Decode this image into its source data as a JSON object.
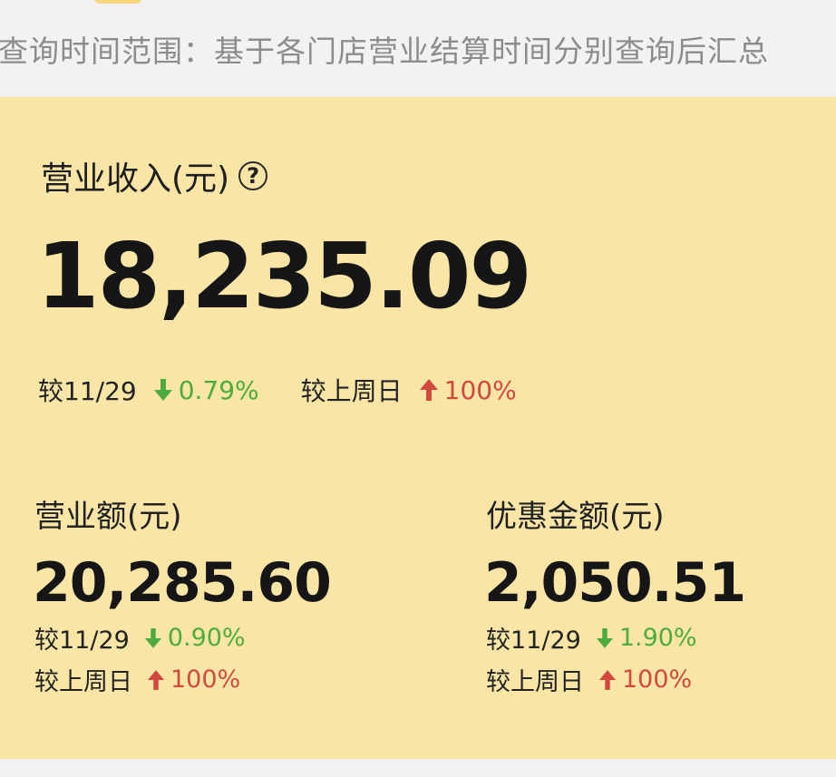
{
  "header": {
    "query_range": "查询时间范围：基于各门店营业结算时间分别查询后汇总"
  },
  "revenue": {
    "title": "营业收入(元)",
    "help_icon": "question-circle-icon",
    "value": "18,235.09",
    "vs_date_label": "较11/29",
    "vs_date_change": "0.79%",
    "vs_date_direction": "down",
    "vs_week_label": "较上周日",
    "vs_week_change": "100%",
    "vs_week_direction": "up"
  },
  "turnover": {
    "title": "营业额(元)",
    "value": "20,285.60",
    "vs_date_label": "较11/29",
    "vs_date_change": "0.90%",
    "vs_date_direction": "down",
    "vs_week_label": "较上周日",
    "vs_week_change": "100%",
    "vs_week_direction": "up"
  },
  "discount": {
    "title": "优惠金额(元)",
    "value": "2,050.51",
    "vs_date_label": "较11/29",
    "vs_date_change": "1.90%",
    "vs_date_direction": "down",
    "vs_week_label": "较上周日",
    "vs_week_change": "100%",
    "vs_week_direction": "up"
  },
  "colors": {
    "card_background": "#f9e6a6",
    "down": "#4eab3d",
    "up": "#d2483e",
    "muted_text": "#8c8c8c"
  }
}
